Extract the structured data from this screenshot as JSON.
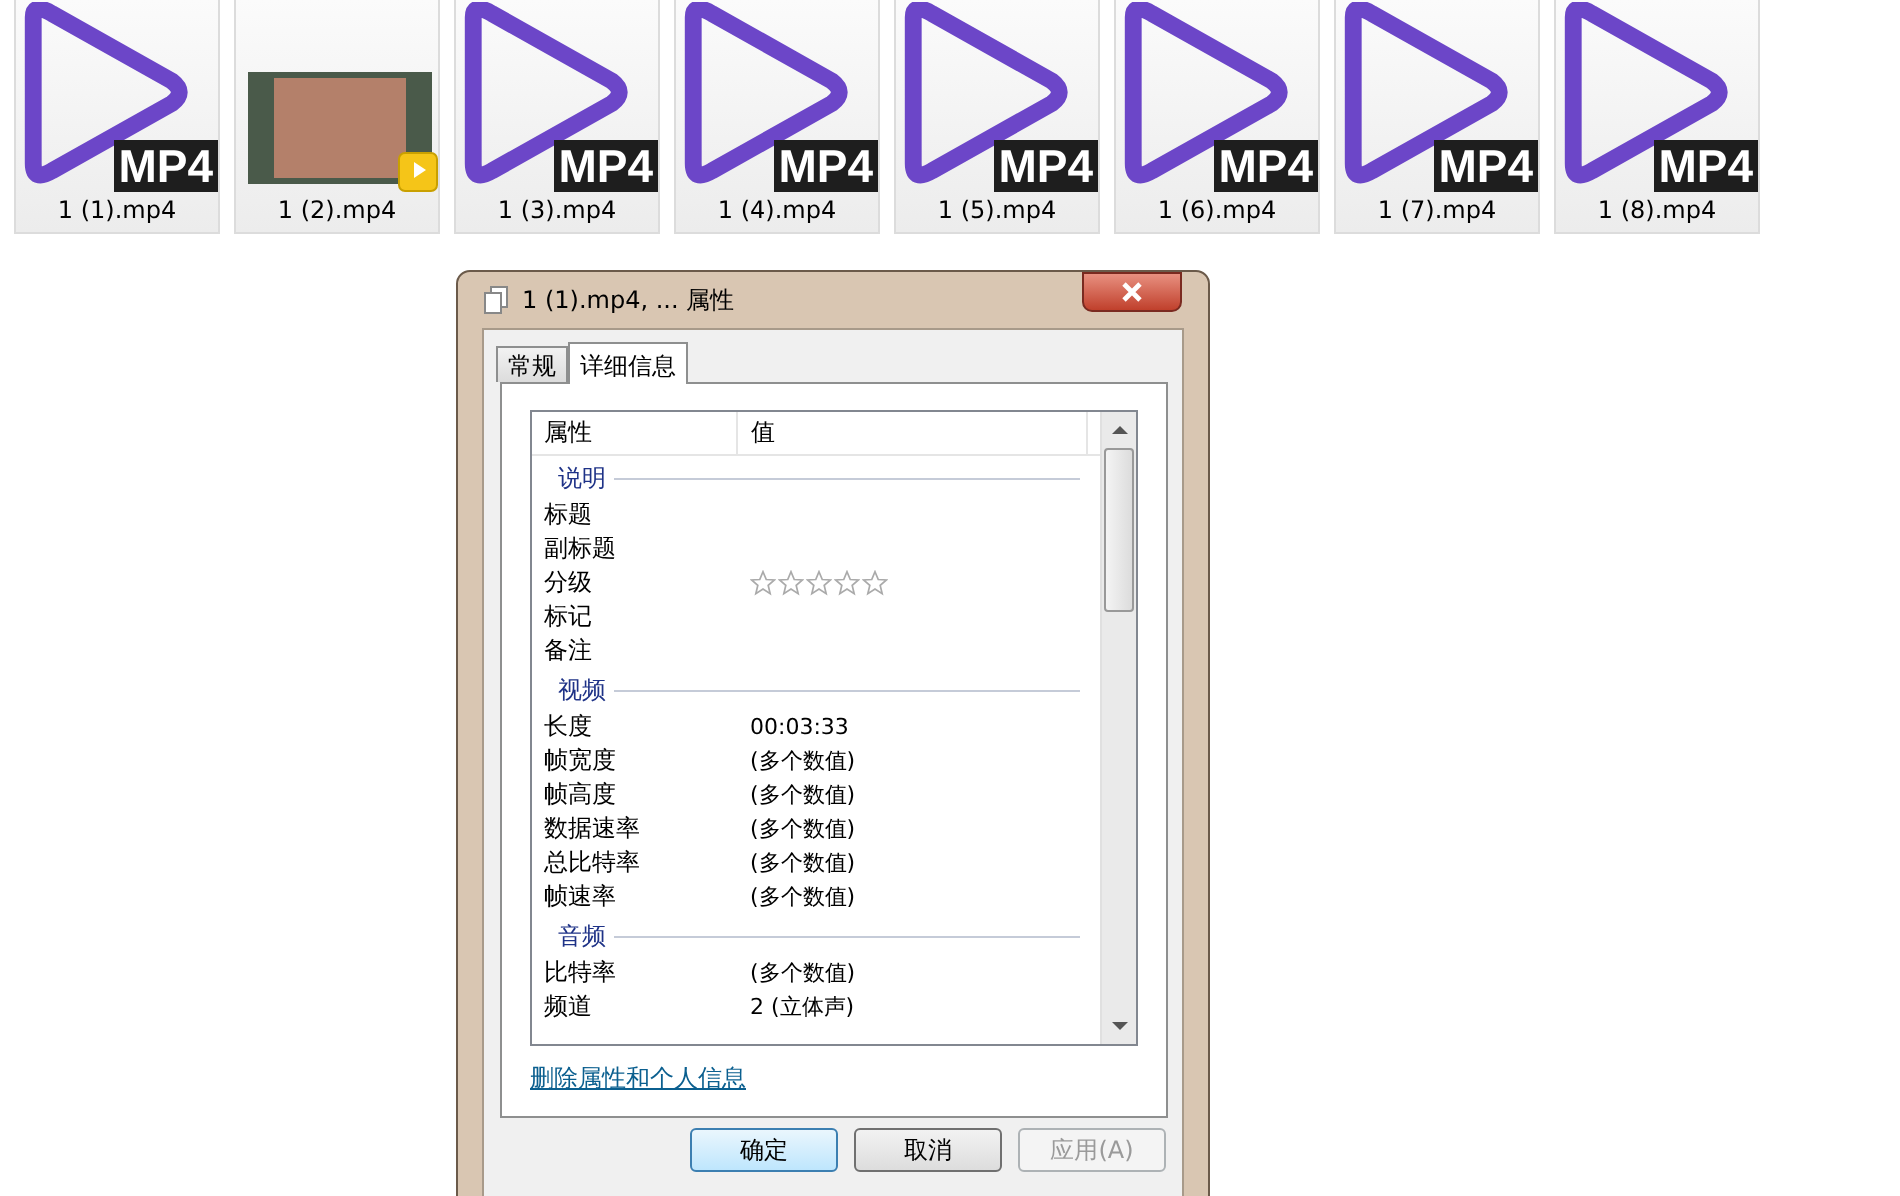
{
  "files": [
    {
      "name": "1 (1).mp4",
      "kind": "mp4",
      "badge": "MP4"
    },
    {
      "name": "1 (2).mp4",
      "kind": "thumbnail"
    },
    {
      "name": "1 (3).mp4",
      "kind": "mp4",
      "badge": "MP4"
    },
    {
      "name": "1 (4).mp4",
      "kind": "mp4",
      "badge": "MP4"
    },
    {
      "name": "1 (5).mp4",
      "kind": "mp4",
      "badge": "MP4"
    },
    {
      "name": "1 (6).mp4",
      "kind": "mp4",
      "badge": "MP4"
    },
    {
      "name": "1 (7).mp4",
      "kind": "mp4",
      "badge": "MP4"
    },
    {
      "name": "1 (8).mp4",
      "kind": "mp4",
      "badge": "MP4"
    }
  ],
  "dialog": {
    "title": "1 (1).mp4, ... 属性",
    "tabs": [
      {
        "label": "常规",
        "selected": false
      },
      {
        "label": "详细信息",
        "selected": true
      }
    ],
    "columns": [
      "属性",
      "值"
    ],
    "groups": [
      {
        "heading": "说明",
        "rows": [
          {
            "name": "标题",
            "kind": "text"
          },
          {
            "name": "副标题",
            "kind": "text"
          },
          {
            "name": "分级",
            "kind": "stars",
            "stars": 0
          },
          {
            "name": "标记",
            "kind": "text"
          },
          {
            "name": "备注",
            "kind": "text"
          }
        ]
      },
      {
        "heading": "视频",
        "rows": [
          {
            "name": "长度",
            "kind": "text",
            "value": "00:03:33"
          },
          {
            "name": "帧宽度",
            "kind": "text",
            "value": "(多个数值)"
          },
          {
            "name": "帧高度",
            "kind": "text",
            "value": "(多个数值)"
          },
          {
            "name": "数据速率",
            "kind": "text",
            "value": "(多个数值)"
          },
          {
            "name": "总比特率",
            "kind": "text",
            "value": "(多个数值)"
          },
          {
            "name": "帧速率",
            "kind": "text",
            "value": "(多个数值)"
          }
        ]
      },
      {
        "heading": "音频",
        "rows": [
          {
            "name": "比特率",
            "kind": "text",
            "value": "(多个数值)"
          },
          {
            "name": "频道",
            "kind": "text",
            "value": "2 (立体声)"
          }
        ]
      }
    ],
    "link": "删除属性和个人信息",
    "buttons": [
      {
        "label": "确定",
        "default": true,
        "disabled": false
      },
      {
        "label": "取消",
        "default": false,
        "disabled": false
      },
      {
        "label": "应用(A)",
        "default": false,
        "disabled": true
      }
    ]
  }
}
